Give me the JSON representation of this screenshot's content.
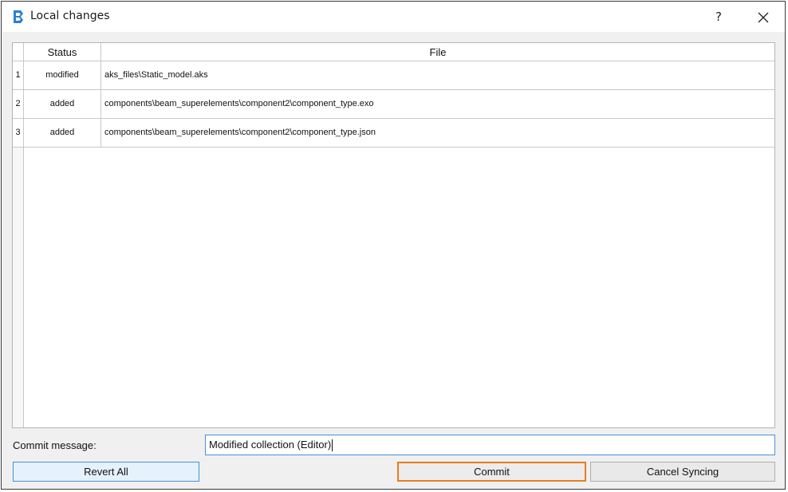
{
  "window": {
    "title": "Local changes",
    "help_label": "?",
    "close_icon": "close-icon"
  },
  "table": {
    "headers": {
      "rownum": "",
      "status": "Status",
      "file": "File"
    },
    "rows": [
      {
        "num": "1",
        "status": "modified",
        "file": "aks_files\\Static_model.aks"
      },
      {
        "num": "2",
        "status": "added",
        "file": "components\\beam_superelements\\component2\\component_type.exo"
      },
      {
        "num": "3",
        "status": "added",
        "file": "components\\beam_superelements\\component2\\component_type.json"
      }
    ]
  },
  "commit_message": {
    "label": "Commit message:",
    "value": "Modified collection (Editor)"
  },
  "buttons": {
    "revert_all": "Revert All",
    "commit": "Commit",
    "cancel_syncing": "Cancel Syncing"
  },
  "colors": {
    "accent": "#4a90d9",
    "focus_outline": "#e87d1e",
    "app_icon": "#2a7fd4"
  }
}
